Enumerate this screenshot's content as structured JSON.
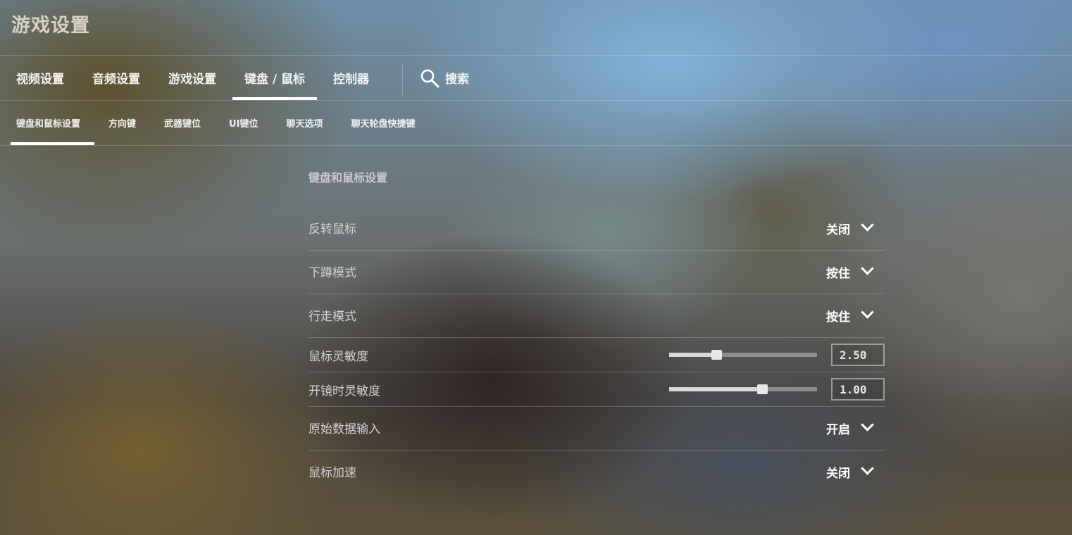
{
  "header": {
    "title": "游戏设置"
  },
  "main_tabs": [
    {
      "label": "视频设置",
      "active": false
    },
    {
      "label": "音频设置",
      "active": false
    },
    {
      "label": "游戏设置",
      "active": false
    },
    {
      "label": "键盘 / 鼠标",
      "active": true
    },
    {
      "label": "控制器",
      "active": false
    }
  ],
  "search": {
    "label": "搜索",
    "icon": "search-icon"
  },
  "sub_tabs": [
    {
      "label": "键盘和鼠标设置",
      "active": true
    },
    {
      "label": "方向键",
      "active": false
    },
    {
      "label": "武器键位",
      "active": false
    },
    {
      "label": "UI键位",
      "active": false
    },
    {
      "label": "聊天选项",
      "active": false
    },
    {
      "label": "聊天轮盘快捷键",
      "active": false
    }
  ],
  "section": {
    "title": "键盘和鼠标设置",
    "rows": [
      {
        "type": "dropdown",
        "label": "反转鼠标",
        "value": "关闭"
      },
      {
        "type": "dropdown",
        "label": "下蹲模式",
        "value": "按住"
      },
      {
        "type": "dropdown",
        "label": "行走模式",
        "value": "按住"
      },
      {
        "type": "slider",
        "label": "鼠标灵敏度",
        "value": "2.50",
        "fill_fraction": 0.32
      },
      {
        "type": "slider",
        "label": "开镜时灵敏度",
        "value": "1.00",
        "fill_fraction": 0.63
      },
      {
        "type": "dropdown",
        "label": "原始数据输入",
        "value": "开启"
      },
      {
        "type": "dropdown",
        "label": "鼠标加速",
        "value": "关闭"
      }
    ]
  },
  "colors": {
    "text_primary": "#ffffff",
    "text_label": "#d2d2d2",
    "active_underline": "#ffffff"
  }
}
